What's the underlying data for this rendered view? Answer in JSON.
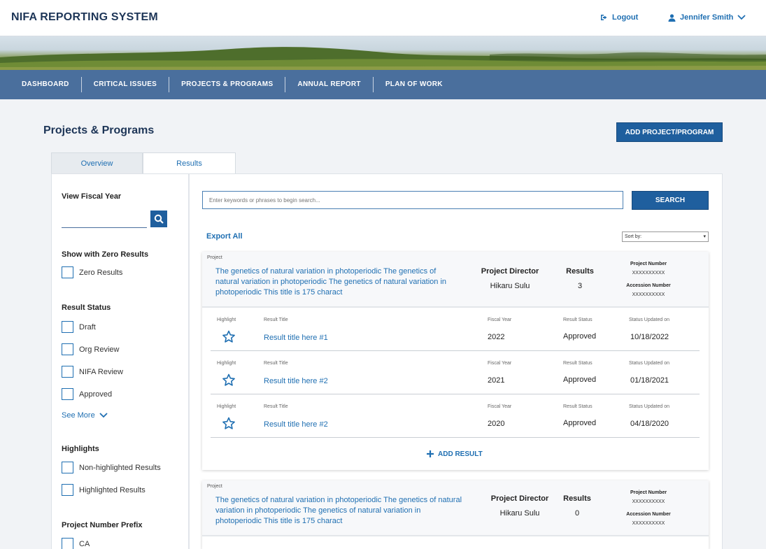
{
  "header": {
    "title": "NIFA REPORTING SYSTEM",
    "logout_label": "Logout",
    "user_name": "Jennifer Smith"
  },
  "nav": {
    "items": [
      {
        "label": "DASHBOARD"
      },
      {
        "label": "CRITICAL ISSUES"
      },
      {
        "label": "PROJECTS & PROGRAMS"
      },
      {
        "label": "ANNUAL REPORT"
      },
      {
        "label": "PLAN OF WORK"
      }
    ]
  },
  "page": {
    "title": "Projects & Programs",
    "add_button": "ADD PROJECT/PROGRAM"
  },
  "tabs": [
    {
      "label": "Overview"
    },
    {
      "label": "Results"
    }
  ],
  "filters": {
    "fiscal_year_heading": "View Fiscal Year",
    "zero_heading": "Show with Zero Results",
    "zero_option": "Zero Results",
    "status_heading": "Result Status",
    "status_options": [
      "Draft",
      "Org Review",
      "NIFA Review",
      "Approved"
    ],
    "see_more": "See More",
    "highlights_heading": "Highlights",
    "highlight_options": [
      "Non-highlighted Results",
      "Highlighted Results"
    ],
    "prefix_heading": "Project Number Prefix",
    "prefix_options": [
      "CA"
    ]
  },
  "search": {
    "placeholder": "Enter keywords or phrases to begin search...",
    "button": "SEARCH"
  },
  "export_all": "Export All",
  "sort_label": "Sort by:",
  "columns": {
    "project_tag": "Project",
    "director": "Project Director",
    "results": "Results",
    "project_number": "Project Number",
    "accession_number": "Accession Number",
    "highlight": "Highlight",
    "result_title": "Result Title",
    "fiscal_year": "Fiscal Year",
    "result_status": "Result Status",
    "status_updated": "Status Updated on"
  },
  "projects": [
    {
      "title": "The genetics of natural variation in photoperiodic The genetics of natural variation in photoperiodic The genetics of natural variation in photoperiodic This title is 175 charact",
      "director": "Hikaru Sulu",
      "results_count": "3",
      "project_number": "XXXXXXXXXX",
      "accession_number": "XXXXXXXXXX",
      "results": [
        {
          "title": "Result title here #1",
          "fiscal_year": "2022",
          "status": "Approved",
          "updated": "10/18/2022"
        },
        {
          "title": "Result title here #2",
          "fiscal_year": "2021",
          "status": "Approved",
          "updated": "01/18/2021"
        },
        {
          "title": "Result title here #2",
          "fiscal_year": "2020",
          "status": "Approved",
          "updated": "04/18/2020"
        }
      ],
      "add_result": "ADD RESULT"
    },
    {
      "title": "The genetics of natural variation in photoperiodic The genetics of natural variation in photoperiodic The genetics of natural variation in photoperiodic This title is 175 charact",
      "director": "Hikaru Sulu",
      "results_count": "0",
      "project_number": "XXXXXXXXXX",
      "accession_number": "XXXXXXXXXX"
    }
  ],
  "colors": {
    "primary": "#1f5f9e",
    "link": "#1f6fb2",
    "nav": "#4a6f9d"
  }
}
